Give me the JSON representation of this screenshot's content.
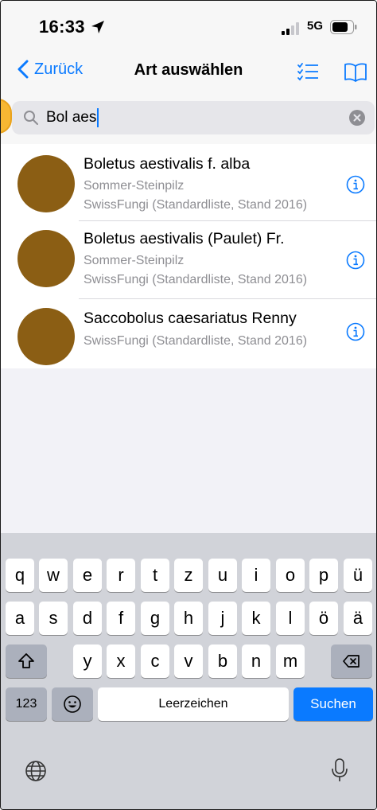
{
  "status_bar": {
    "time": "16:33",
    "network": "5G"
  },
  "nav": {
    "back_label": "Zurück",
    "title": "Art auswählen"
  },
  "search": {
    "value": "Bol aes"
  },
  "results": [
    {
      "scientific_name": "Boletus aestivalis f. alba",
      "common_name": "Sommer-Steinpilz",
      "source": "SwissFungi (Standardliste, Stand 2016)"
    },
    {
      "scientific_name": "Boletus aestivalis (Paulet) Fr.",
      "common_name": "Sommer-Steinpilz",
      "source": "SwissFungi (Standardliste, Stand 2016)"
    },
    {
      "scientific_name": "Saccobolus caesariatus Renny",
      "source": "SwissFungi (Standardliste, Stand 2016)"
    }
  ],
  "colors": {
    "accent": "#0a7aff",
    "avatar": "#8b5e14",
    "highlight": "#f7b733"
  },
  "keyboard": {
    "row1": [
      "q",
      "w",
      "e",
      "r",
      "t",
      "z",
      "u",
      "i",
      "o",
      "p",
      "ü"
    ],
    "row2": [
      "a",
      "s",
      "d",
      "f",
      "g",
      "h",
      "j",
      "k",
      "l",
      "ö",
      "ä"
    ],
    "row3": [
      "y",
      "x",
      "c",
      "v",
      "b",
      "n",
      "m"
    ],
    "numbers_label": "123",
    "space_label": "Leerzeichen",
    "return_label": "Suchen"
  }
}
